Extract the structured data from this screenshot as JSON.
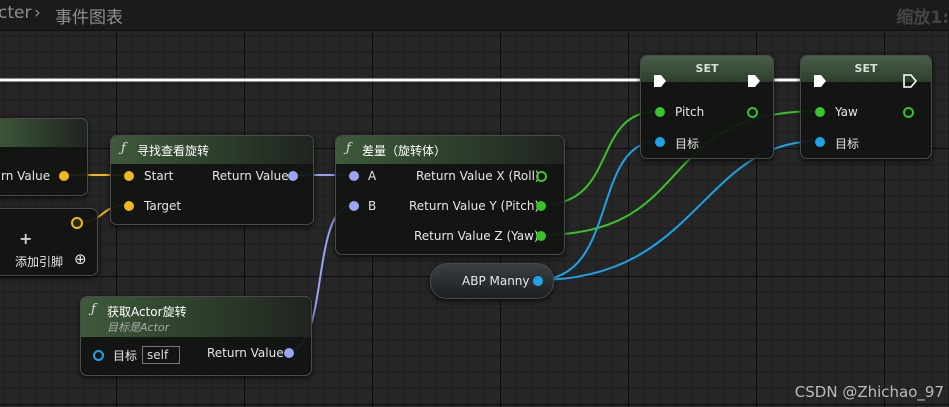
{
  "header": {
    "breadcrumb_prev": "cter",
    "separator": "›",
    "breadcrumb_current": "事件图表",
    "zoom_label": "缩放1:"
  },
  "nodes": {
    "partial_top_left": {
      "output_label": "rn Value"
    },
    "partial_add_pin": {
      "label": "添加引脚"
    },
    "find_look_at": {
      "title": "寻找查看旋转",
      "start_label": "Start",
      "target_label": "Target",
      "return_label": "Return Value"
    },
    "delta_rotator": {
      "title": "差量（旋转体）",
      "a_label": "A",
      "b_label": "B",
      "x_label": "Return Value X (Roll)",
      "y_label": "Return Value Y (Pitch)",
      "z_label": "Return Value Z (Yaw)"
    },
    "get_actor_rotation": {
      "title": "获取Actor旋转",
      "subtitle": "目标是Actor",
      "target_label": "目标",
      "target_value": "self",
      "return_label": "Return Value"
    },
    "set_pitch": {
      "title": "SET",
      "var_label": "Pitch",
      "target_label": "目标"
    },
    "set_yaw": {
      "title": "SET",
      "var_label": "Yaw",
      "target_label": "目标"
    },
    "abp_manny": {
      "label": "ABP Manny"
    }
  },
  "icons": {
    "function": "ƒ",
    "plus": "+",
    "add_circle": "⊕"
  },
  "colors": {
    "exec": "#ffffff",
    "rotator": "#9aa4f0",
    "vector": "#f0b820",
    "float": "#39c22b",
    "object": "#1fa3e6"
  },
  "watermark": "CSDN @Zhichao_97"
}
